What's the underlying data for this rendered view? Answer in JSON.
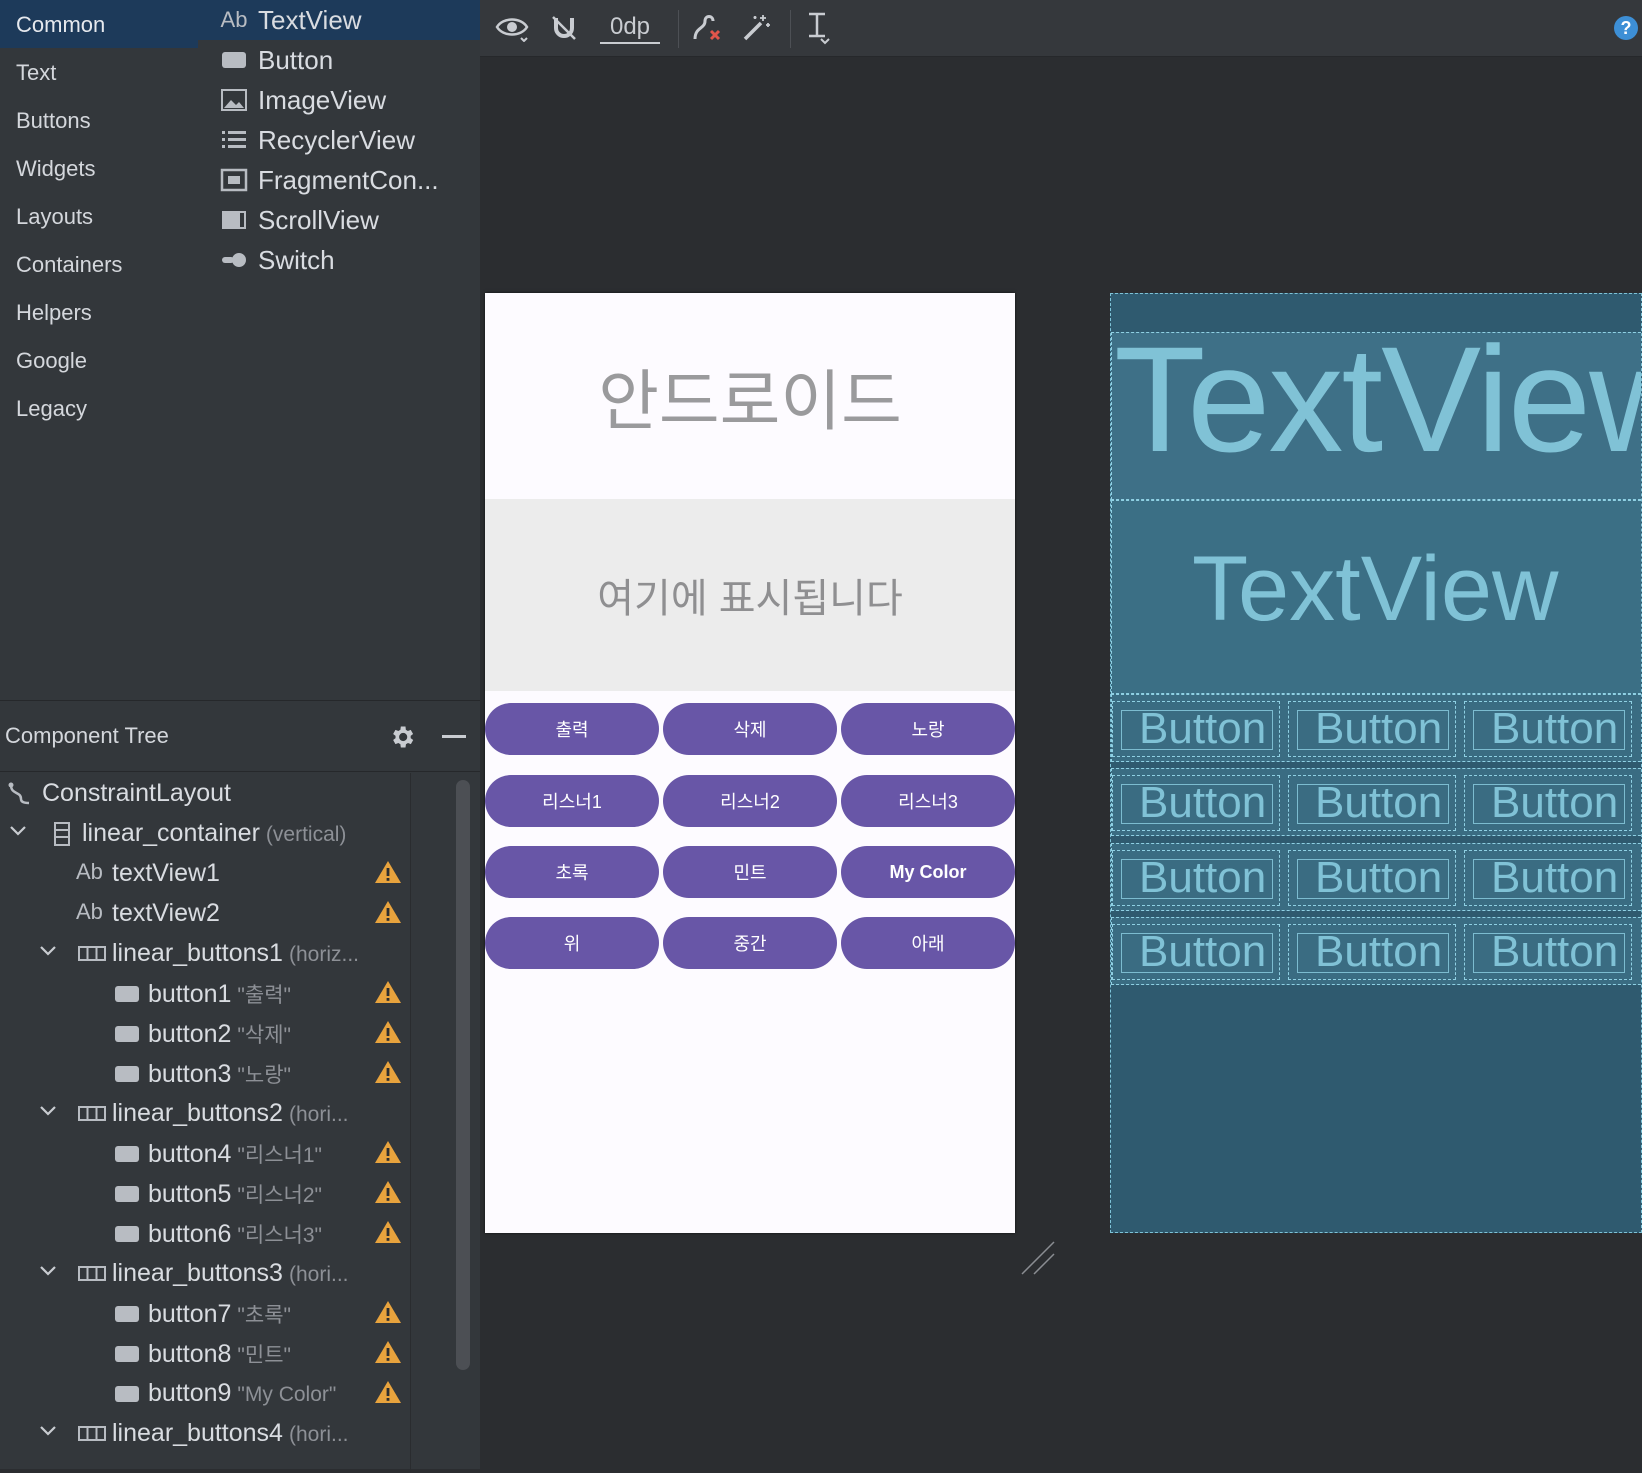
{
  "palette": {
    "categories": [
      "Common",
      "Text",
      "Buttons",
      "Widgets",
      "Layouts",
      "Containers",
      "Helpers",
      "Google",
      "Legacy"
    ],
    "widgets": [
      {
        "label": "TextView",
        "icon": "ab-text-icon",
        "icon_text": "Ab"
      },
      {
        "label": "Button",
        "icon": "button-icon"
      },
      {
        "label": "ImageView",
        "icon": "image-icon"
      },
      {
        "label": "RecyclerView",
        "icon": "list-icon"
      },
      {
        "label": "FragmentCon...",
        "icon": "fragment-icon"
      },
      {
        "label": "ScrollView",
        "icon": "scroll-icon"
      },
      {
        "label": "Switch",
        "icon": "switch-icon"
      }
    ]
  },
  "tree": {
    "title": "Component Tree",
    "rows": [
      {
        "name": "ConstraintLayout",
        "hint": "",
        "depth": 0,
        "icon": "constraint-icon",
        "chevron": false,
        "warn": false
      },
      {
        "name": "linear_container",
        "hint": "(vertical)",
        "depth": 1,
        "icon": "vertical-layout-icon",
        "chevron": true,
        "warn": false
      },
      {
        "name": "textView1",
        "hint": "",
        "depth": 2,
        "icon": "ab-text-icon",
        "chevron": false,
        "warn": true
      },
      {
        "name": "textView2",
        "hint": "",
        "depth": 2,
        "icon": "ab-text-icon",
        "chevron": false,
        "warn": true
      },
      {
        "name": "linear_buttons1",
        "hint": "(horiz...",
        "depth": 2,
        "icon": "horizontal-layout-icon",
        "chevron": true,
        "warn": false
      },
      {
        "name": "button1",
        "hint": "\"출력\"",
        "depth": 3,
        "icon": "button-icon",
        "chevron": false,
        "warn": true
      },
      {
        "name": "button2",
        "hint": "\"삭제\"",
        "depth": 3,
        "icon": "button-icon",
        "chevron": false,
        "warn": true
      },
      {
        "name": "button3",
        "hint": "\"노랑\"",
        "depth": 3,
        "icon": "button-icon",
        "chevron": false,
        "warn": true
      },
      {
        "name": "linear_buttons2",
        "hint": "(hori...",
        "depth": 2,
        "icon": "horizontal-layout-icon",
        "chevron": true,
        "warn": false
      },
      {
        "name": "button4",
        "hint": "\"리스너1\"",
        "depth": 3,
        "icon": "button-icon",
        "chevron": false,
        "warn": true
      },
      {
        "name": "button5",
        "hint": "\"리스너2\"",
        "depth": 3,
        "icon": "button-icon",
        "chevron": false,
        "warn": true
      },
      {
        "name": "button6",
        "hint": "\"리스너3\"",
        "depth": 3,
        "icon": "button-icon",
        "chevron": false,
        "warn": true
      },
      {
        "name": "linear_buttons3",
        "hint": "(hori...",
        "depth": 2,
        "icon": "horizontal-layout-icon",
        "chevron": true,
        "warn": false
      },
      {
        "name": "button7",
        "hint": "\"초록\"",
        "depth": 3,
        "icon": "button-icon",
        "chevron": false,
        "warn": true
      },
      {
        "name": "button8",
        "hint": "\"민트\"",
        "depth": 3,
        "icon": "button-icon",
        "chevron": false,
        "warn": true
      },
      {
        "name": "button9",
        "hint": "\"My Color\"",
        "depth": 3,
        "icon": "button-icon",
        "chevron": false,
        "warn": true
      },
      {
        "name": "linear_buttons4",
        "hint": "(hori...",
        "depth": 2,
        "icon": "horizontal-layout-icon",
        "chevron": true,
        "warn": false
      }
    ]
  },
  "toolbar": {
    "margin_value": "0dp"
  },
  "design": {
    "text1": "안드로이드",
    "text2": "여기에 표시됩니다",
    "button_rows": [
      [
        {
          "label": "출력"
        },
        {
          "label": "삭제"
        },
        {
          "label": "노랑"
        }
      ],
      [
        {
          "label": "리스너1"
        },
        {
          "label": "리스너2"
        },
        {
          "label": "리스너3"
        }
      ],
      [
        {
          "label": "초록"
        },
        {
          "label": "민트"
        },
        {
          "label": "My Color"
        }
      ],
      [
        {
          "label": "위"
        },
        {
          "label": "중간"
        },
        {
          "label": "아래"
        }
      ]
    ]
  },
  "blueprint": {
    "text1": "TextView",
    "text2": "TextView",
    "button_label": "Button"
  },
  "colors": {
    "button_purple": "#6856a7",
    "selection_blue": "#1d3a5a",
    "warning": "#e8a33d",
    "blueprint_bg": "#2f5a6f",
    "blueprint_text": "#80c2d6"
  }
}
